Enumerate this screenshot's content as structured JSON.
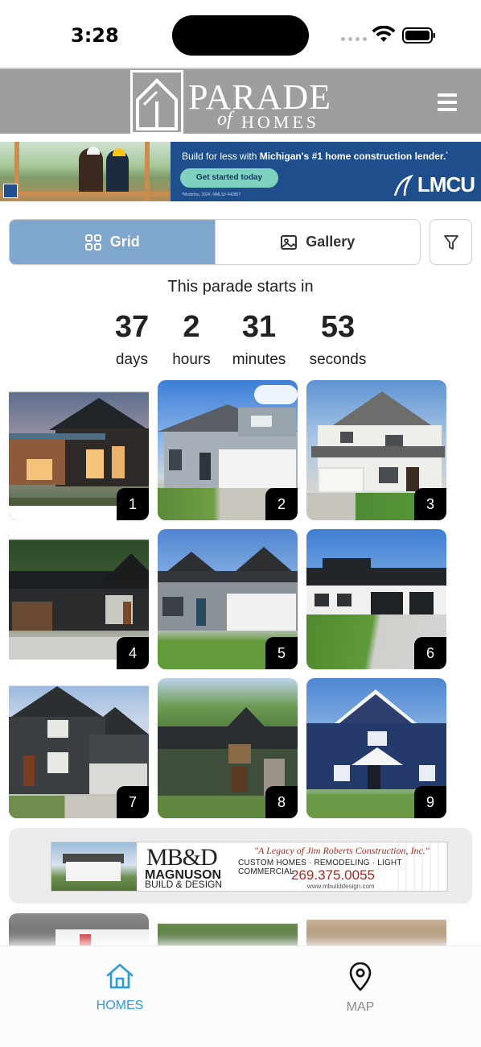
{
  "status_bar": {
    "time": "3:28"
  },
  "header": {
    "logo_word_main": "PARADE",
    "logo_word_of": "of",
    "logo_word_homes": "HOMES"
  },
  "top_ad": {
    "headline_prefix": "Build for less with ",
    "headline_bold": "Michigan's #1 home construction lender.",
    "headline_mark": "*",
    "cta_label": "Get started today",
    "fine_print": "*Moderbu, 2024, NMLS# 442867",
    "brand": "LMCU"
  },
  "view_toggle": {
    "grid_label": "Grid",
    "gallery_label": "Gallery",
    "active": "grid"
  },
  "countdown": {
    "title": "This parade starts in",
    "units": [
      {
        "value": "37",
        "label": "days"
      },
      {
        "value": "2",
        "label": "hours"
      },
      {
        "value": "31",
        "label": "minutes"
      },
      {
        "value": "53",
        "label": "seconds"
      }
    ]
  },
  "homes": [
    {
      "number": "1"
    },
    {
      "number": "2"
    },
    {
      "number": "3"
    },
    {
      "number": "4"
    },
    {
      "number": "5"
    },
    {
      "number": "6"
    },
    {
      "number": "7"
    },
    {
      "number": "8"
    },
    {
      "number": "9"
    }
  ],
  "sponsor_ad": {
    "logo": "MB&D",
    "name_line1": "MAGNUSON",
    "name_line2": "BUILD & DESIGN",
    "legacy": "\"A Legacy of Jim Roberts Construction, Inc.\"",
    "services": "CUSTOM HOMES · REMODELING · LIGHT COMMERCIAL",
    "phone": "269.375.0055",
    "url": "www.mbuilddesign.com"
  },
  "tab_bar": {
    "homes_label": "HOMES",
    "map_label": "MAP",
    "active": "homes"
  },
  "colors": {
    "header_bg": "#9e9e9e",
    "toggle_active": "#7fa7cd",
    "tab_active": "#2b9bd9",
    "tab_inactive": "#8a8a8a",
    "ad_bg": "#1e4e8c"
  },
  "icons": [
    "wifi-icon",
    "battery-icon",
    "menu-icon",
    "grid-icon",
    "image-icon",
    "filter-icon",
    "home-icon",
    "map-pin-icon"
  ]
}
